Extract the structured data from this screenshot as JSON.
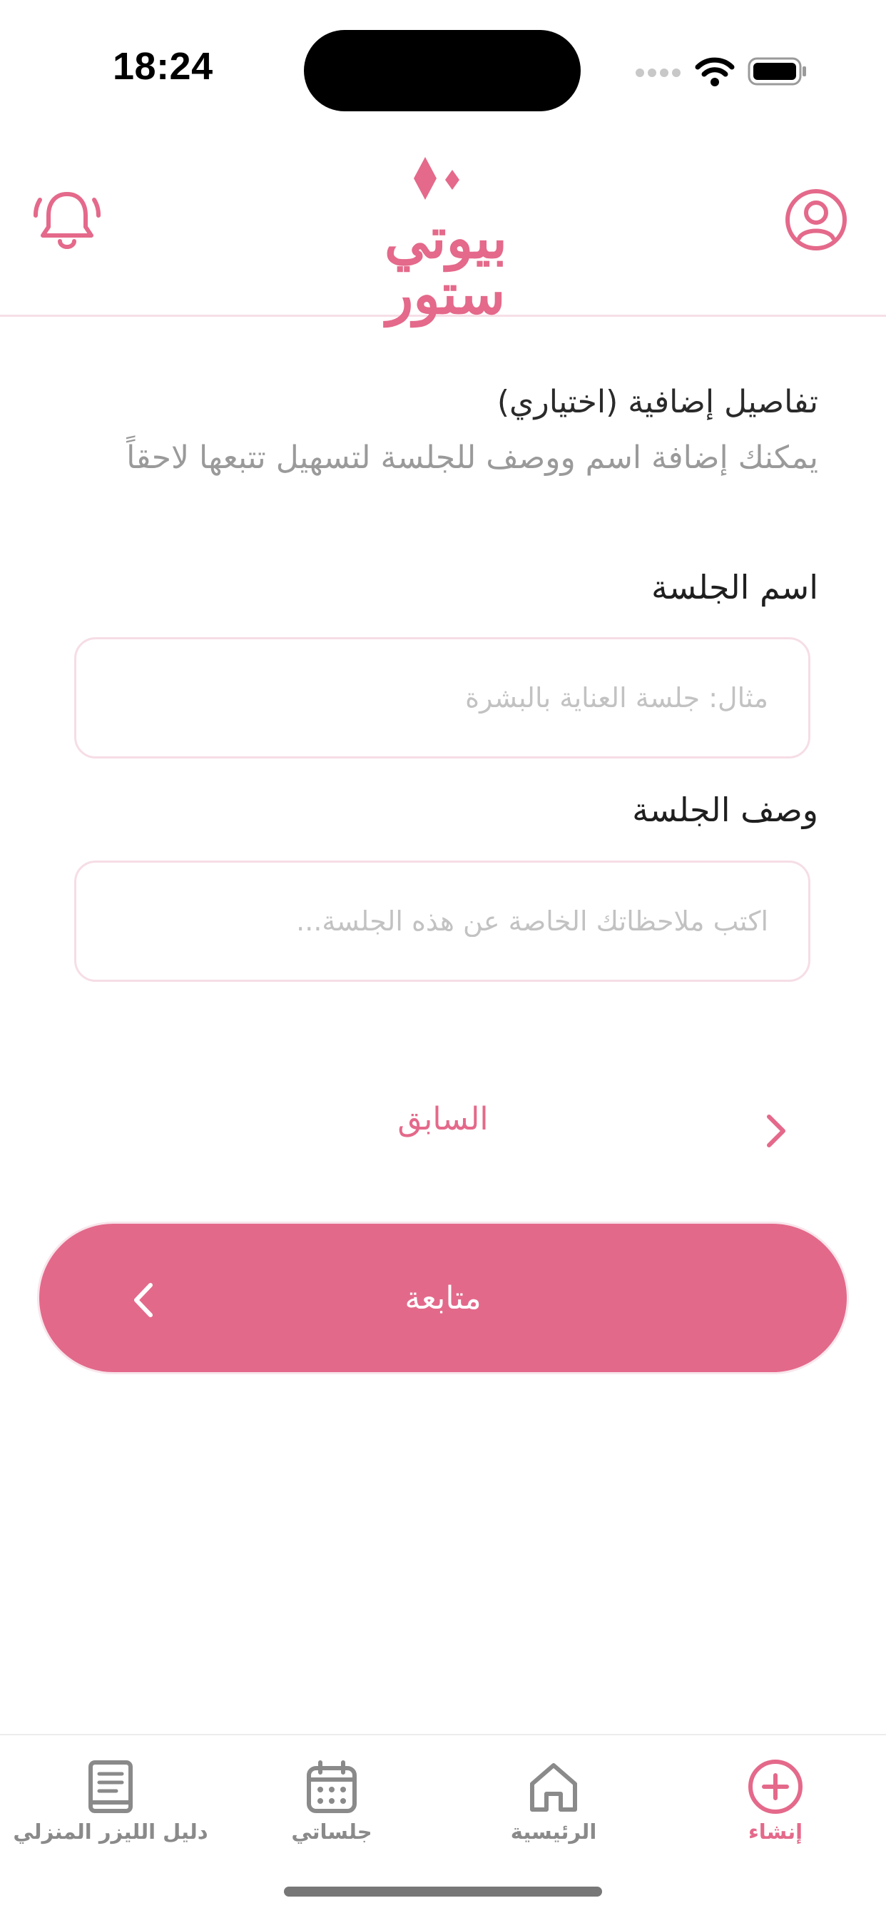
{
  "status_bar": {
    "time": "18:24"
  },
  "header": {
    "logo_text": "بيوتي ستور",
    "bell_icon": "bell-icon",
    "profile_icon": "user-circle-icon"
  },
  "colors": {
    "accent": "#e3698a",
    "placeholder": "#c2c2c2",
    "muted": "#9a9a9a",
    "border": "#f6dde6"
  },
  "section": {
    "title": "تفاصيل إضافية (اختياري)",
    "description": "يمكنك إضافة اسم ووصف للجلسة لتسهيل تتبعها لاحقاً"
  },
  "fields": {
    "session_name": {
      "label": "اسم الجلسة",
      "value": "",
      "placeholder": "مثال: جلسة العناية بالبشرة"
    },
    "session_description": {
      "label": "وصف الجلسة",
      "value": "",
      "placeholder": "اكتب ملاحظاتك الخاصة عن هذه الجلسة..."
    }
  },
  "actions": {
    "previous_label": "السابق",
    "continue_label": "متابعة"
  },
  "tabbar": {
    "tabs": [
      {
        "label": "إنشاء",
        "icon": "plus-circle-icon",
        "active": true
      },
      {
        "label": "الرئيسية",
        "icon": "home-icon",
        "active": false
      },
      {
        "label": "جلساتي",
        "icon": "calendar-icon",
        "active": false
      },
      {
        "label": "دليل الليزر المنزلي",
        "icon": "book-icon",
        "active": false
      }
    ]
  }
}
